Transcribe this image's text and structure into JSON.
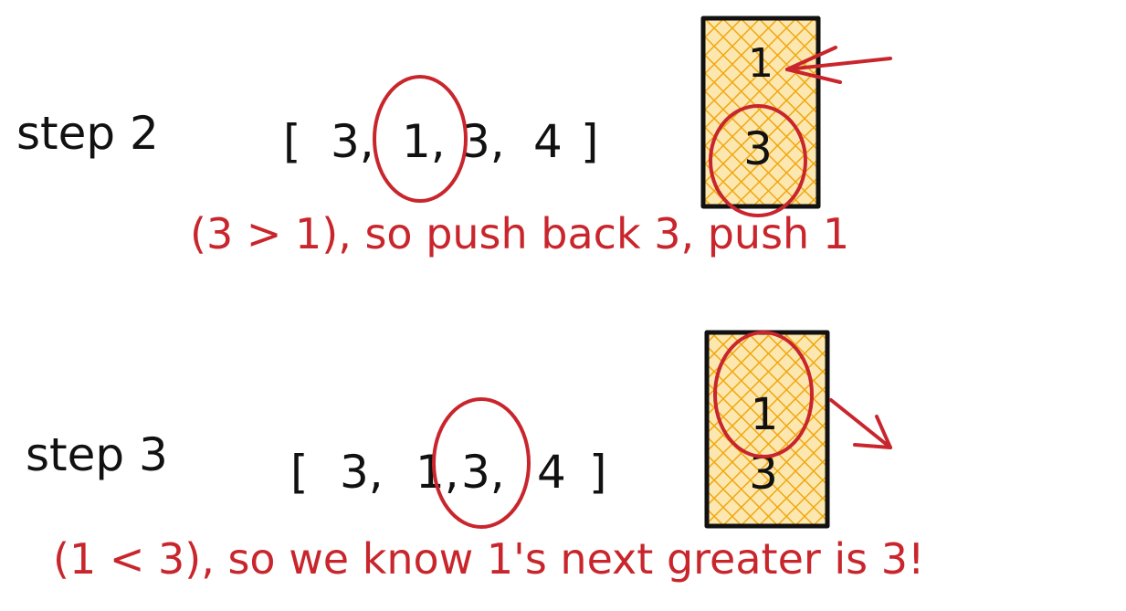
{
  "colors": {
    "ink": "#111111",
    "annotation": "#c8262c",
    "stack_fill": "#f5b21a",
    "background": "#ffffff"
  },
  "step2": {
    "label": "step 2",
    "array": {
      "open": "[",
      "items": [
        "3,",
        "1,",
        "3,",
        "4"
      ],
      "close": "]"
    },
    "stack": [
      "1",
      "3"
    ],
    "note": "(3 > 1), so push back 3, push 1",
    "circled_item": "1,",
    "circled_stack_value": "3",
    "arrow": "pointing-into-stack"
  },
  "step3": {
    "label": "step 3",
    "array": {
      "open": "[",
      "items": [
        "3,",
        "1,",
        "3,",
        "4"
      ],
      "close": "]"
    },
    "stack": [
      "1",
      "3"
    ],
    "note": "(1 < 3), so we know 1's next greater is 3!",
    "circled_item": "3,",
    "circled_stack_value": "1",
    "arrow": "pointing-out-of-stack"
  }
}
